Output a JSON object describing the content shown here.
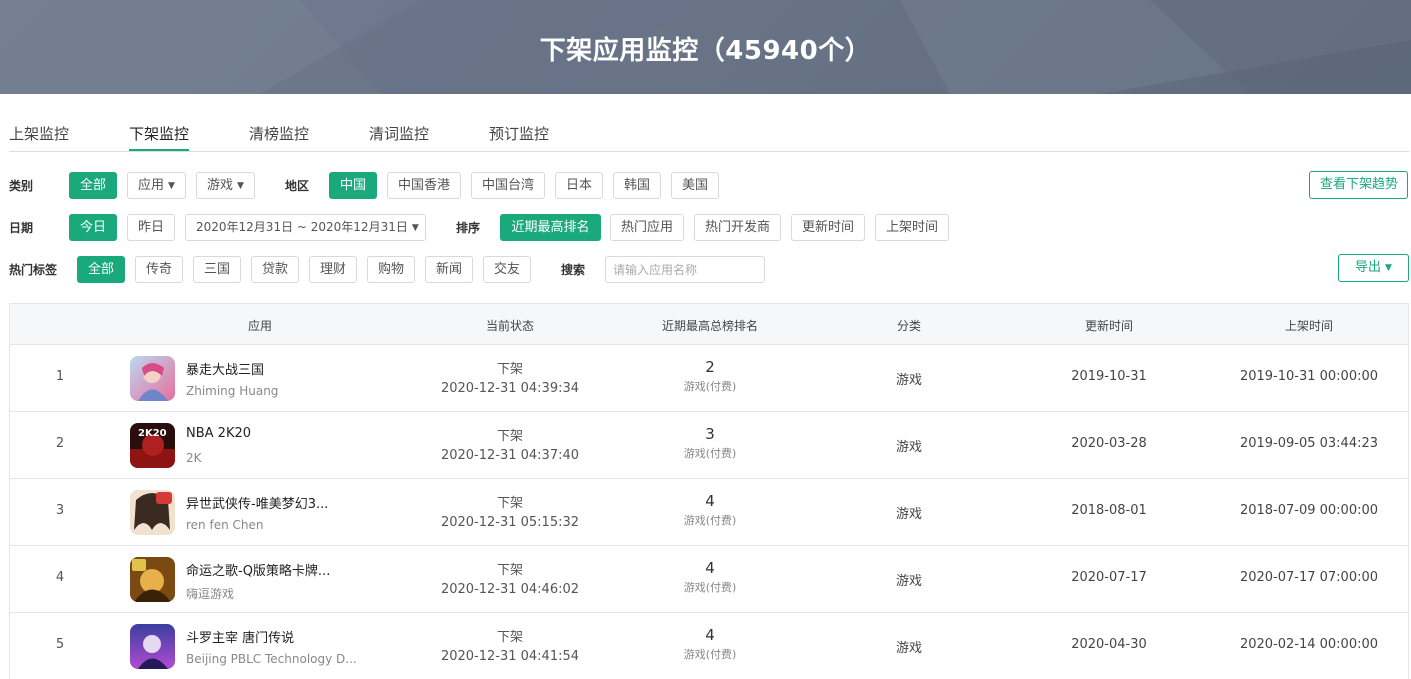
{
  "banner": {
    "title": "下架应用监控（45940个）"
  },
  "tabs": [
    "上架监控",
    "下架监控",
    "清榜监控",
    "清词监控",
    "预订监控"
  ],
  "filters": {
    "category": {
      "label": "类别",
      "options": [
        "全部",
        "应用",
        "游戏"
      ]
    },
    "region": {
      "label": "地区",
      "options": [
        "中国",
        "中国香港",
        "中国台湾",
        "日本",
        "韩国",
        "美国"
      ]
    },
    "trend_button": "查看下架趋势",
    "date": {
      "label": "日期",
      "options": [
        "今日",
        "昨日"
      ],
      "range": "2020年12月31日 ~ 2020年12月31日"
    },
    "sort": {
      "label": "排序",
      "options": [
        "近期最高排名",
        "热门应用",
        "热门开发商",
        "更新时间",
        "上架时间"
      ]
    },
    "tags": {
      "label": "热门标签",
      "options": [
        "全部",
        "传奇",
        "三国",
        "贷款",
        "理财",
        "购物",
        "新闻",
        "交友"
      ]
    },
    "search": {
      "label": "搜索",
      "placeholder": "请输入应用名称"
    },
    "export_button": "导出"
  },
  "table": {
    "columns": [
      "应用",
      "当前状态",
      "近期最高总榜排名",
      "分类",
      "更新时间",
      "上架时间"
    ],
    "rows": [
      {
        "idx": "1",
        "name": "暴走大战三国",
        "dev": "Zhiming Huang",
        "status": "下架",
        "status_time": "2020-12-31 04:39:34",
        "rank": "2",
        "rank_cat": "游戏(付费)",
        "category": "游戏",
        "updated": "2019-10-31",
        "released": "2019-10-31 00:00:00"
      },
      {
        "idx": "2",
        "name": "NBA 2K20",
        "dev": "2K",
        "status": "下架",
        "status_time": "2020-12-31 04:37:40",
        "rank": "3",
        "rank_cat": "游戏(付费)",
        "category": "游戏",
        "updated": "2020-03-28",
        "released": "2019-09-05 03:44:23"
      },
      {
        "idx": "3",
        "name": "异世武侠传-唯美梦幻3...",
        "dev": "ren fen Chen",
        "status": "下架",
        "status_time": "2020-12-31 05:15:32",
        "rank": "4",
        "rank_cat": "游戏(付费)",
        "category": "游戏",
        "updated": "2018-08-01",
        "released": "2018-07-09 00:00:00"
      },
      {
        "idx": "4",
        "name": "命运之歌-Q版策略卡牌...",
        "dev": "嗨逗游戏",
        "status": "下架",
        "status_time": "2020-12-31 04:46:02",
        "rank": "4",
        "rank_cat": "游戏(付费)",
        "category": "游戏",
        "updated": "2020-07-17",
        "released": "2020-07-17 07:00:00"
      },
      {
        "idx": "5",
        "name": "斗罗主宰 唐门传说",
        "dev": "Beijing PBLC Technology D...",
        "status": "下架",
        "status_time": "2020-12-31 04:41:54",
        "rank": "4",
        "rank_cat": "游戏(付费)",
        "category": "游戏",
        "updated": "2020-04-30",
        "released": "2020-02-14 00:00:00"
      }
    ]
  },
  "colors": {
    "accent": "#19a97b",
    "banner": "#6a7588"
  },
  "icons": [
    "caret-down-icon",
    "app-icon"
  ]
}
